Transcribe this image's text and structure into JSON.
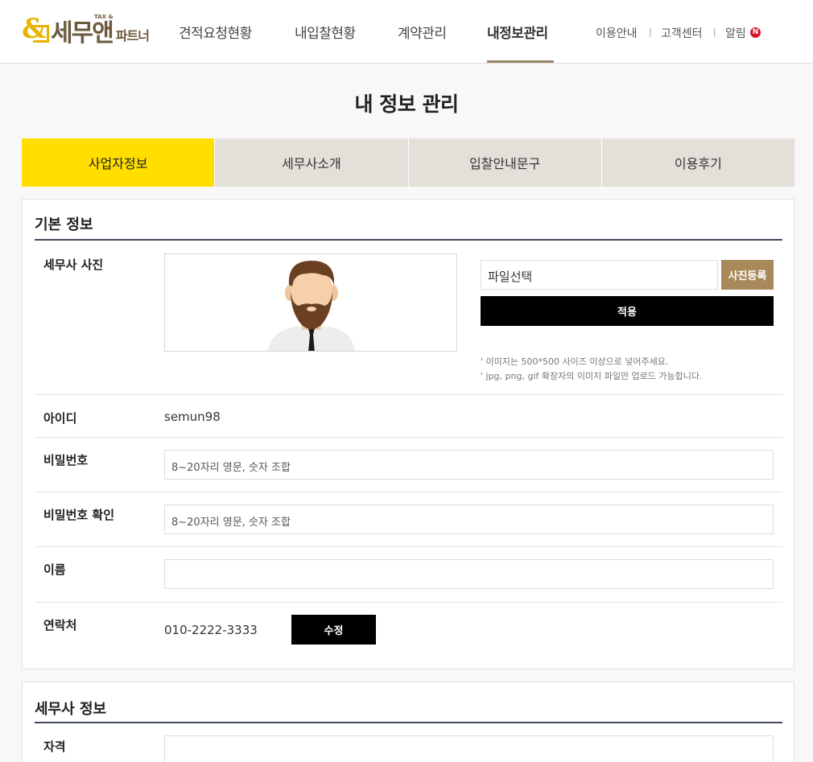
{
  "header": {
    "logo_text": "세무앤",
    "logo_tax": "TAX &",
    "logo_sub": "파트너",
    "nav": [
      "견적요청현황",
      "내입찰현황",
      "계약관리",
      "내정보관리"
    ],
    "active_nav": "내정보관리",
    "util": [
      "이용안내",
      "고객센터",
      "알림"
    ],
    "alert_badge": "N",
    "separator": "|"
  },
  "page": {
    "title": "내 정보 관리"
  },
  "tabs": [
    "사업자정보",
    "세무사소개",
    "입찰안내문구",
    "이용후기"
  ],
  "active_tab": "사업자정보",
  "basic": {
    "title": "기본 정보",
    "photo_label": "세무사 사진",
    "file_placeholder": "파일선택",
    "register_button": "사진등록",
    "apply_button": "적용",
    "notes": [
      "' 이미지는 500*500 사이즈 이상으로 넣어주세요.",
      "' jpg, png, gif 확장자의 이미지 파일만 업로드 가능합니다."
    ],
    "id_label": "아이디",
    "id_value": "semun98",
    "password_label": "비밀번호",
    "password_placeholder": "8~20자리 영문, 숫자 조합",
    "password_confirm_label": "비밀번호 확인",
    "password_confirm_placeholder": "8~20자리 영문, 숫자 조합",
    "name_label": "이름",
    "name_value": "",
    "contact_label": "연락처",
    "contact_value": "010-2222-3333",
    "edit_button": "수정"
  },
  "tax_info": {
    "title": "세무사 정보",
    "qualification_label": "자격",
    "qualification_value": ""
  },
  "colors": {
    "accent_yellow": "#ffde00",
    "gold": "#a8895a",
    "logo_brown": "#6b5a3e",
    "alert_red": "#d9152c"
  }
}
